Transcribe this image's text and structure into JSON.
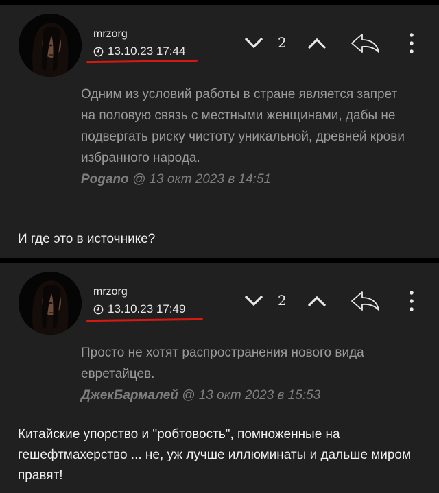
{
  "comments": [
    {
      "author": "mrzorg",
      "datetime": "13.10.23 17:44",
      "votes": "2",
      "quote_text": "Одним из условий работы в стране является запрет на половую связь с местными женщинами, дабы не подвергать риску чистоту уникальной, древней крови избранного народа.",
      "quote_author": "Pogano",
      "quote_time": "@ 13 окт 2023 в 14:51",
      "text": "И где это в источнике?"
    },
    {
      "author": "mrzorg",
      "datetime": "13.10.23 17:49",
      "votes": "2",
      "quote_text": "Просто не хотят распространения нового вида евретайцев.",
      "quote_author": "ДжекБармалей",
      "quote_time": "@ 13 окт 2023 в 15:53",
      "text": "Китайские упорство и \"робтовость\", помноженные на гешефтмахерство ... не, уж лучше иллюминаты и дальше миром правят!"
    }
  ],
  "icons": {
    "clock": "clock-icon",
    "downvote": "chevron-down-icon",
    "upvote": "chevron-up-icon",
    "reply": "reply-icon",
    "more": "more-vertical-icon"
  },
  "colors": {
    "background": "#202020",
    "separator": "#000000",
    "underline": "#d51a12",
    "quote_text": "#9a9a9a"
  }
}
